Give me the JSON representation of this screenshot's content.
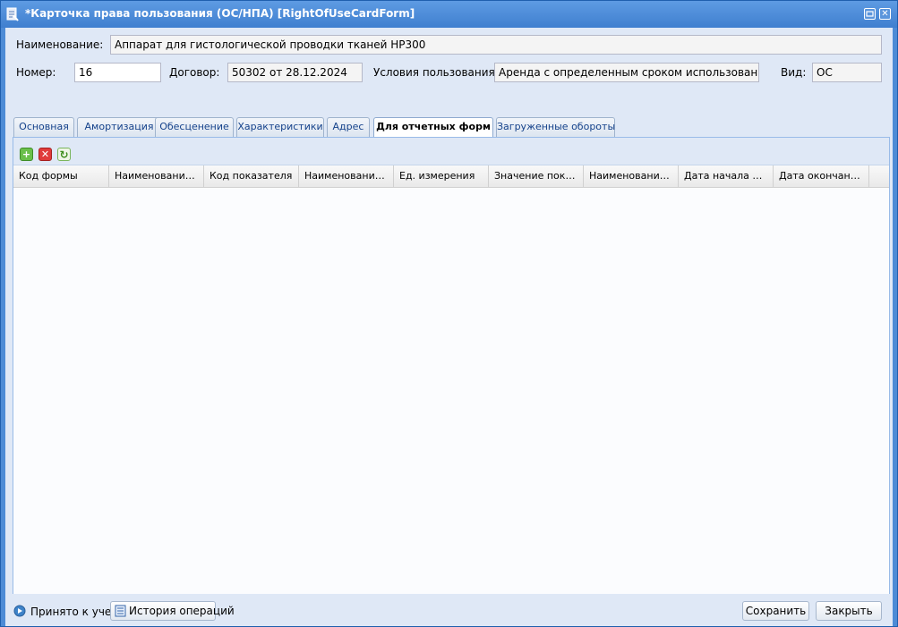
{
  "window": {
    "title": "*Карточка права пользования (ОС/НПА) [RightOfUseCardForm]",
    "restore_icon": "restore-icon",
    "close_glyph": "✕"
  },
  "form": {
    "name_label": "Наименование:",
    "name_value": "Аппарат для гистологической проводки тканей HP300",
    "number_label": "Номер:",
    "number_value": "16",
    "contract_label": "Договор:",
    "contract_value": "50302 от 28.12.2024",
    "conditions_label": "Условия пользования:",
    "conditions_value": "Аренда с определенным сроком использования",
    "kind_label": "Вид:",
    "kind_value": "ОС"
  },
  "tabs": [
    {
      "label": "Основная"
    },
    {
      "label": "Амортизация"
    },
    {
      "label": "Обесценение"
    },
    {
      "label": "Характеристики"
    },
    {
      "label": "Адрес"
    },
    {
      "label": "Для отчетных форм"
    },
    {
      "label": "Загруженные обороты"
    }
  ],
  "active_tab": "Для отчетных форм",
  "toolbar": {
    "add_icon": "add-icon",
    "delete_icon": "delete-icon",
    "refresh_icon": "refresh-icon"
  },
  "grid": {
    "columns": [
      "Код формы",
      "Наименование ф...",
      "Код показателя",
      "Наименование п...",
      "Ед. измерения",
      "Значение показа...",
      "Наименование з...",
      "Дата начала дей...",
      "Дата окончания ..."
    ],
    "rows": []
  },
  "footer": {
    "accepted_label": "Принято к учету",
    "history_button": "История операций",
    "save_button": "Сохранить",
    "close_button": "Закрыть"
  }
}
